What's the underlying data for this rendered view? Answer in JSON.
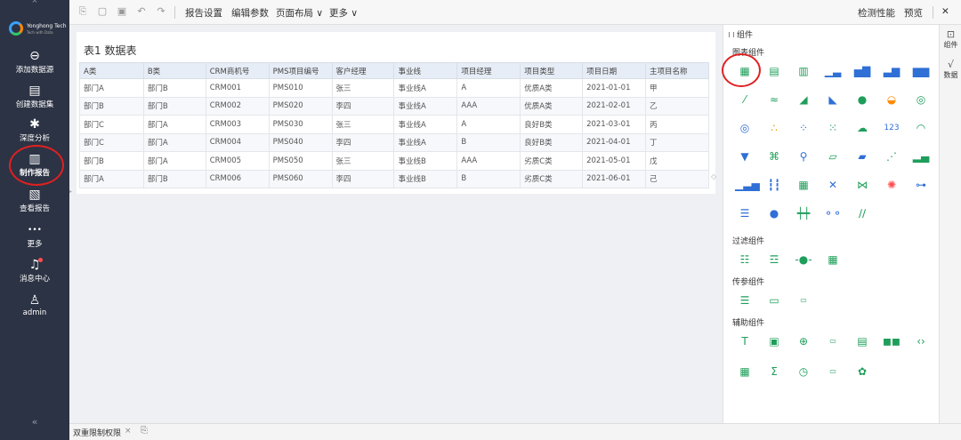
{
  "sidebar": {
    "logo_line1": "Yonghong Tech",
    "logo_line2": "Tech with Data",
    "items": [
      {
        "icon": "link-icon",
        "glyph": "⊖",
        "label": "添加数据源"
      },
      {
        "icon": "dataset-icon",
        "glyph": "▤",
        "label": "创建数据集"
      },
      {
        "icon": "analysis-icon",
        "glyph": "✱",
        "label": "深度分析"
      },
      {
        "icon": "report-make-icon",
        "glyph": "▥",
        "label": "制作报告"
      },
      {
        "icon": "report-view-icon",
        "glyph": "▧",
        "label": "查看报告"
      },
      {
        "icon": "more-icon",
        "glyph": "•••",
        "label": "更多"
      },
      {
        "icon": "bell-icon",
        "glyph": "♫",
        "label": "消息中心"
      },
      {
        "icon": "user-icon",
        "glyph": "♙",
        "label": "admin"
      }
    ],
    "collapse_glyph": "«",
    "top_glyph": "^"
  },
  "toolbar": {
    "menus": [
      "报告设置",
      "编辑参数",
      "页面布局 ∨",
      "更多 ∨"
    ],
    "right": [
      "检测性能",
      "预览"
    ],
    "close_glyph": "✕"
  },
  "report": {
    "title": "表1 数据表",
    "columns": [
      "A类",
      "B类",
      "CRM商机号",
      "PMS项目编号",
      "客户经理",
      "事业线",
      "项目经理",
      "项目类型",
      "项目日期",
      "主项目名称"
    ],
    "rows": [
      [
        "部门A",
        "部门B",
        "CRM001",
        "PMS010",
        "张三",
        "事业线A",
        "A",
        "优质A类",
        "2021-01-01",
        "甲"
      ],
      [
        "部门B",
        "部门B",
        "CRM002",
        "PMS020",
        "李四",
        "事业线A",
        "AAA",
        "优质A类",
        "2021-02-01",
        "乙"
      ],
      [
        "部门C",
        "部门A",
        "CRM003",
        "PMS030",
        "张三",
        "事业线A",
        "A",
        "良好B类",
        "2021-03-01",
        "丙"
      ],
      [
        "部门C",
        "部门A",
        "CRM004",
        "PMS040",
        "李四",
        "事业线A",
        "B",
        "良好B类",
        "2021-04-01",
        "丁"
      ],
      [
        "部门B",
        "部门A",
        "CRM005",
        "PMS050",
        "张三",
        "事业线B",
        "AAA",
        "劣质C类",
        "2021-05-01",
        "戊"
      ],
      [
        "部门A",
        "部门B",
        "CRM006",
        "PMS060",
        "李四",
        "事业线B",
        "B",
        "劣质C类",
        "2021-06-01",
        "己"
      ]
    ]
  },
  "panel": {
    "header": "组件",
    "sections": [
      "图表组件",
      "过滤组件",
      "传参组件",
      "辅助组件"
    ]
  },
  "vtabs": [
    {
      "label": "组件",
      "glyph": "⊡"
    },
    {
      "label": "数据",
      "glyph": "√"
    }
  ],
  "bottom": {
    "tab_label": "双重限制权限",
    "close_glyph": "×",
    "add_glyph": "⎘"
  },
  "colors": {
    "sidebar_bg": "#2c3344",
    "accent_green": "#1e9e5a",
    "accent_blue": "#2f6fd6",
    "highlight_red": "#e02020"
  }
}
